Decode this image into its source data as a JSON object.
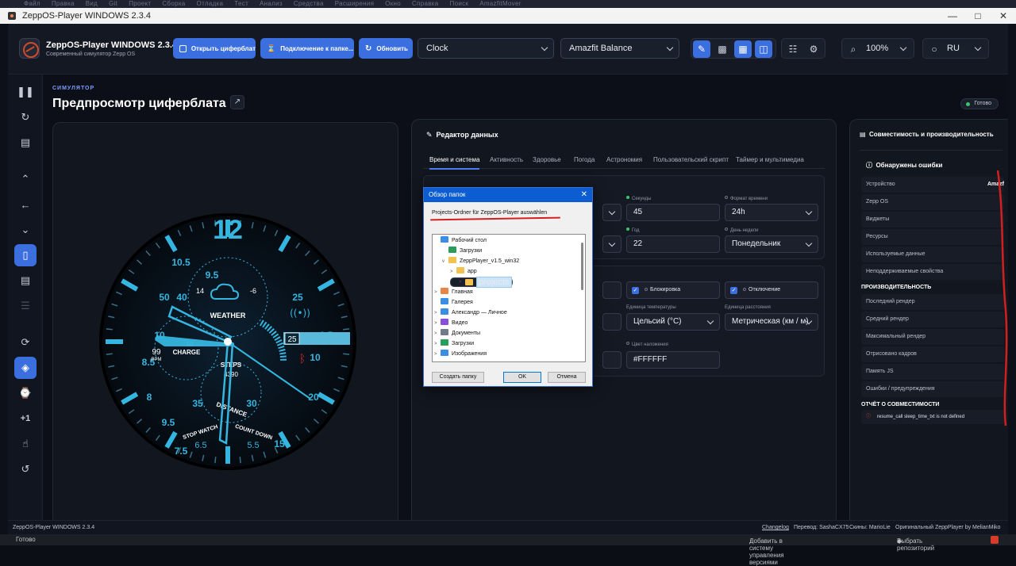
{
  "vscode_menu": [
    "Файл",
    "Правка",
    "Вид",
    "Git",
    "Проект",
    "Сборка",
    "Отладка",
    "Тест",
    "Анализ",
    "Средства",
    "Расширения",
    "Окно",
    "Справка",
    "Поиск",
    "AmazfitMover"
  ],
  "window": {
    "title": "ZeppOS-Player WINDOWS 2.3.4"
  },
  "header": {
    "app_name": "ZeppOS-Player WINDOWS 2.3.4",
    "app_sub": "Современный симулятор Zepp OS",
    "open_face_label": "Открыть циферблат",
    "connect_folder_label": "Подключение к папке...",
    "refresh_label": "Обновить",
    "watchface_select": "Clock",
    "device_select": "Amazfit Balance",
    "zoom": "100%",
    "lang": "RU"
  },
  "main": {
    "kicker": "СИМУЛЯТОР",
    "title": "Предпросмотр циферблата",
    "status": "Готово"
  },
  "watch": {
    "top_number": "12",
    "ring_numbers": [
      "50",
      "10.5",
      "10",
      "9.5",
      "8.5",
      "8",
      "7.5",
      "9.5",
      "40",
      "35",
      "30",
      "25",
      "20",
      "15",
      "10",
      "2.5"
    ],
    "weather_label": "WEATHER",
    "weather_left": "14",
    "weather_right": "-6",
    "bpm_value": "99",
    "bpm_label": "BPM",
    "charge_label": "CHARGE",
    "charge_value": "50",
    "steps_label": "STEPS",
    "steps_value": "4390",
    "distance_label": "DISTANCE",
    "date_value": "25",
    "stopwatch_label": "STOP WATCH",
    "stopwatch_value": "6.5",
    "countdown_label": "COUNT DOWN",
    "countdown_value": "5.5"
  },
  "editor": {
    "title": "Редактор данных",
    "tabs": [
      "Время и система",
      "Активность",
      "Здоровье",
      "Погода",
      "Астрономия",
      "Пользовательский скрипт",
      "Таймер и мультимедиа"
    ],
    "seconds_label": "Секунды",
    "seconds_value": "45",
    "timeformat_label": "Формат времени",
    "timeformat_value": "24h",
    "year_label": "Год",
    "year_value": "22",
    "weekday_label": "День недели",
    "weekday_value": "Понедельник",
    "lock_label": "Блокировка",
    "disconnect_label": "Отключение",
    "tempunit_label": "Единица температуры",
    "tempunit_value": "Цельсий (°C)",
    "distunit_label": "Единица расстояния",
    "distunit_value": "Метрическая (км / м)",
    "overlay_label": "Цвет наложения",
    "overlay_value": "#FFFFFF"
  },
  "dialog": {
    "title": "Обзор папок",
    "hint": "Projects-Ordner für ZeppOS-Player auswählen",
    "tree": [
      {
        "label": "Рабочий стол",
        "icon": "desktop-icon"
      },
      {
        "label": "Загрузки",
        "icon": "download-icon"
      },
      {
        "label": "ZeppPlayer_v1.5_win32",
        "icon": "folder-icon"
      },
      {
        "label": "app",
        "icon": "folder-icon"
      },
      {
        "label": "projects",
        "icon": "folder-icon"
      },
      {
        "label": "Главная",
        "icon": "home-icon"
      },
      {
        "label": "Галерея",
        "icon": "gallery-icon"
      },
      {
        "label": "Александр — Личное",
        "icon": "cloud-icon"
      },
      {
        "label": "Видео",
        "icon": "video-icon"
      },
      {
        "label": "Документы",
        "icon": "documents-icon"
      },
      {
        "label": "Загрузки",
        "icon": "download-icon"
      },
      {
        "label": "Изображения",
        "icon": "images-icon"
      }
    ],
    "new_folder": "Создать папку",
    "ok": "OK",
    "cancel": "Отмена"
  },
  "compat": {
    "title": "Совместимость и производительность",
    "errors_title": "Обнаружены ошибки",
    "device_row": "Устройство",
    "device_value": "Amazf",
    "rows": [
      "Zepp OS",
      "Виджеты",
      "Ресурсы",
      "Используемые данные",
      "Неподдерживаемые свойства"
    ],
    "perf_title": "ПРОИЗВОДИТЕЛЬНОСТЬ",
    "perf_rows": [
      "Последний рендер",
      "Средний рендер",
      "Максимальный рендер",
      "Отрисовано кадров",
      "Память JS",
      "Ошибки / предупреждения"
    ],
    "report_title": "ОТЧЁТ О СОВМЕСТИМОСТИ",
    "error_msg": "resume_call sleep_time_txt is not defined"
  },
  "footer": {
    "left": "ZeppOS-Player WINDOWS 2.3.4",
    "changelog": "Changelog",
    "translation": "Перевод: SashaCX75",
    "skins": "Скины: MarioLie",
    "original": "Оригинальный ZeppPlayer by MelianMiko"
  },
  "taskbar": {
    "ready": "Готово",
    "vcs": "Добавить в систему управления версиями",
    "repo": "Выбрать репозиторий"
  },
  "colors": {
    "accent": "#3b6fe0",
    "watch_cyan": "#35b6e0",
    "error_red": "#d41f1f"
  }
}
